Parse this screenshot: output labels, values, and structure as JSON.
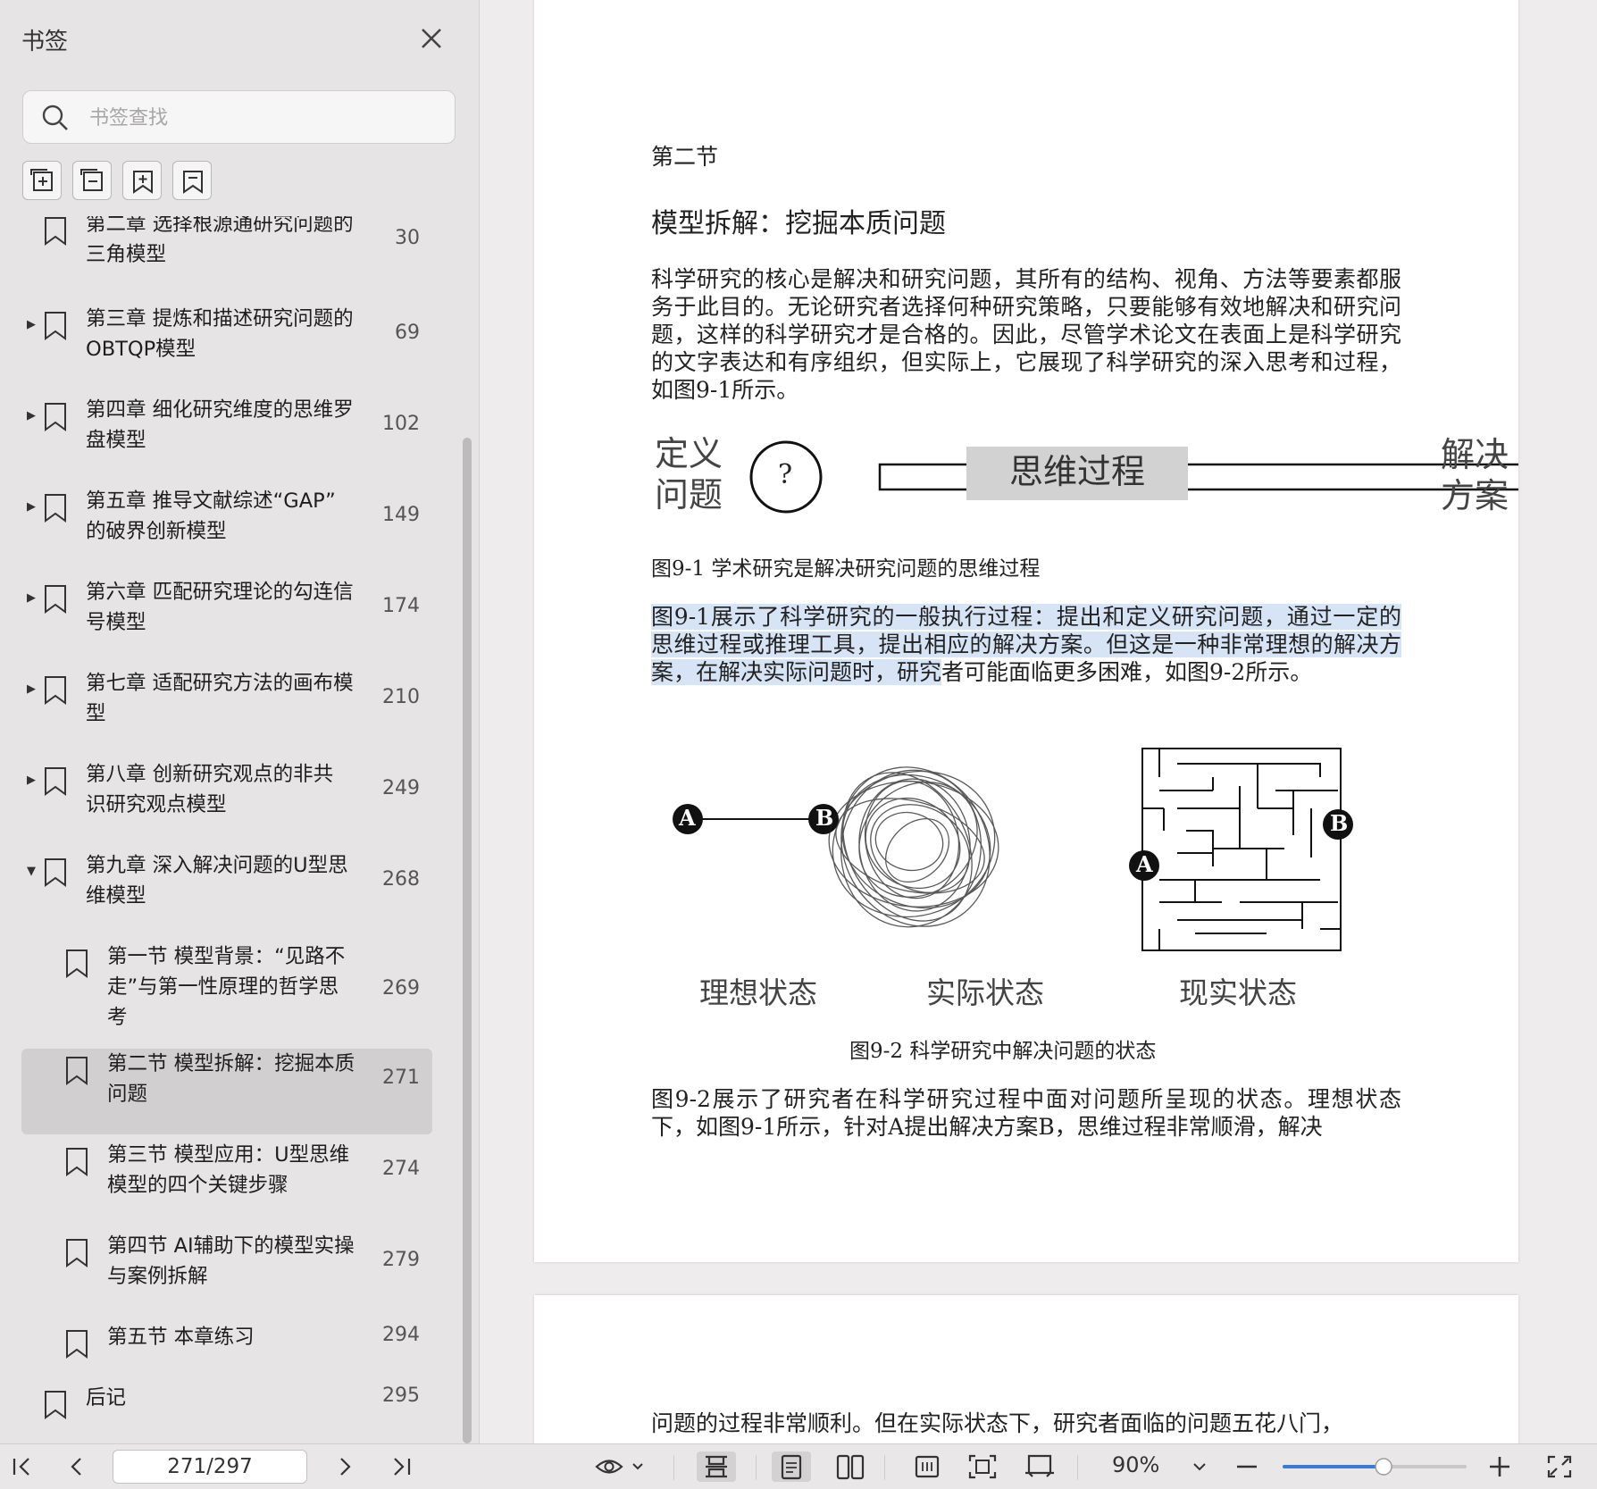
{
  "sidebar": {
    "title": "书签",
    "search_placeholder": "书签查找",
    "tools": [
      "add-bookmark-icon",
      "collapse-all-icon",
      "add-child-bookmark-icon",
      "bookmark-icon"
    ],
    "items": [
      {
        "label": "第二章 选择根源通研究问题的",
        "label2": "三角模型",
        "page": "30",
        "has_arrow": false,
        "expanded": false,
        "indent": 0
      },
      {
        "label": "第三章 提炼和描述研究问题的",
        "label2": "OBTQP模型",
        "page": "69",
        "has_arrow": true,
        "expanded": false,
        "indent": 0
      },
      {
        "label": "第四章 细化研究维度的思维罗",
        "label2": "盘模型",
        "page": "102",
        "has_arrow": true,
        "expanded": false,
        "indent": 0
      },
      {
        "label": "第五章 推导文献综述“GAP”",
        "label2": "的破界创新模型",
        "page": "149",
        "has_arrow": true,
        "expanded": false,
        "indent": 0
      },
      {
        "label": "第六章 匹配研究理论的勾连信",
        "label2": "号模型",
        "page": "174",
        "has_arrow": true,
        "expanded": false,
        "indent": 0
      },
      {
        "label": "第七章 适配研究方法的画布模",
        "label2": "型",
        "page": "210",
        "has_arrow": true,
        "expanded": false,
        "indent": 0
      },
      {
        "label": "第八章 创新研究观点的非共",
        "label2": "识研究观点模型",
        "page": "249",
        "has_arrow": true,
        "expanded": false,
        "indent": 0
      },
      {
        "label": "第九章 深入解决问题的U型思",
        "label2": "维模型",
        "page": "268",
        "has_arrow": true,
        "expanded": true,
        "indent": 0
      },
      {
        "label": "第一节 模型背景：“见路不",
        "label2": "走”与第一性原理的哲学思",
        "label3": "考",
        "page": "269",
        "indent": 1
      },
      {
        "label": "第二节 模型拆解：挖掘本质",
        "label2": "问题",
        "page": "271",
        "indent": 1,
        "selected": true
      },
      {
        "label": "第三节 模型应用：U型思维",
        "label2": "模型的四个关键步骤",
        "page": "274",
        "indent": 1
      },
      {
        "label": "第四节 AI辅助下的模型实操",
        "label2": "与案例拆解",
        "page": "279",
        "indent": 1
      },
      {
        "label": "第五节 本章练习",
        "label2": "",
        "page": "294",
        "indent": 1
      },
      {
        "label": "后记",
        "label2": "",
        "page": "295",
        "indent": 0
      }
    ]
  },
  "document": {
    "section": "第二节",
    "heading": "模型拆解：挖掘本质问题",
    "para1": "科学研究的核心是解决和研究问题，其所有的结构、视角、方法等要素都服务于此目的。无论研究者选择何种研究策略，只要能够有效地解决和研究问题，这样的科学研究才是合格的。因此，尽管学术论文在表面上是科学研究的文字表达和有序组织，但实际上，它展现了科学研究的深入思考和过程，如图9-1所示。",
    "fig1": {
      "left_line1": "定义",
      "left_line2": "问题",
      "question_mark": "?",
      "box_label": "思维过程",
      "right_line1": "解决",
      "right_line2": "方案",
      "caption": "图9-1  学术研究是解决研究问题的思维过程"
    },
    "para2_highlighted": "图9-1展示了科学研究的一般执行过程：提出和定义研究问题，通过一定的思维过程或推理工具，提出相应的解决方案。但这是一种非常理想的解决方案，在解决实际问题时，研究",
    "para2_rest": "者可能面临更多困难，如图9-2所示。",
    "fig2": {
      "point_a": "A",
      "point_b": "B",
      "label1": "理想状态",
      "label2": "实际状态",
      "label3": "现实状态",
      "caption": "图9-2  科学研究中解决问题的状态"
    },
    "para3": "图9-2展示了研究者在科学研究过程中面对问题所呈现的状态。理想状态下，如图9-1所示，针对A提出解决方案B，思维过程非常顺滑，解决",
    "page2_text": "问题的过程非常顺利。但在实际状态下，研究者面临的问题五花八门，"
  },
  "toolbar": {
    "page_value": "271/297",
    "zoom": "90%",
    "icons": [
      "first-page-icon",
      "prev-page-icon",
      "next-page-icon",
      "last-page-icon",
      "eye-icon",
      "fit-width-icon",
      "single-page-icon",
      "two-page-icon",
      "continuous-icon",
      "fit-page-icon",
      "page-crop-icon",
      "zoom-out-icon",
      "zoom-in-icon",
      "fullscreen-icon"
    ],
    "zoom_level": 0.55
  }
}
